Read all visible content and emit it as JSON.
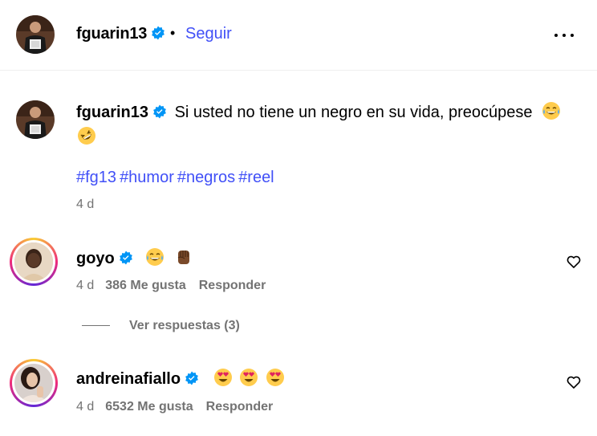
{
  "post": {
    "author": "fguarin13",
    "follow_label": "Seguir",
    "separator": "•"
  },
  "caption": {
    "author": "fguarin13",
    "text": "Si usted no tiene un negro en su vida, preocúpese",
    "hashtags": [
      "#fg13",
      "#humor",
      "#negros",
      "#reel"
    ],
    "time": "4 d"
  },
  "comments": [
    {
      "author": "goyo",
      "emojis": [
        "grinning-sweat-emoji",
        "raised-fist-dark-emoji"
      ],
      "time": "4 d",
      "likes": "386 Me gusta",
      "reply_label": "Responder"
    },
    {
      "author": "andreinafiallo",
      "emojis": [
        "heart-eyes-emoji",
        "heart-eyes-emoji",
        "heart-eyes-emoji"
      ],
      "time": "4 d",
      "likes": "6532 Me gusta",
      "reply_label": "Responder"
    }
  ],
  "view_replies": "Ver respuestas (3)",
  "colors": {
    "link": "#4150f7",
    "verified": "#0095f6",
    "muted": "#737373"
  }
}
